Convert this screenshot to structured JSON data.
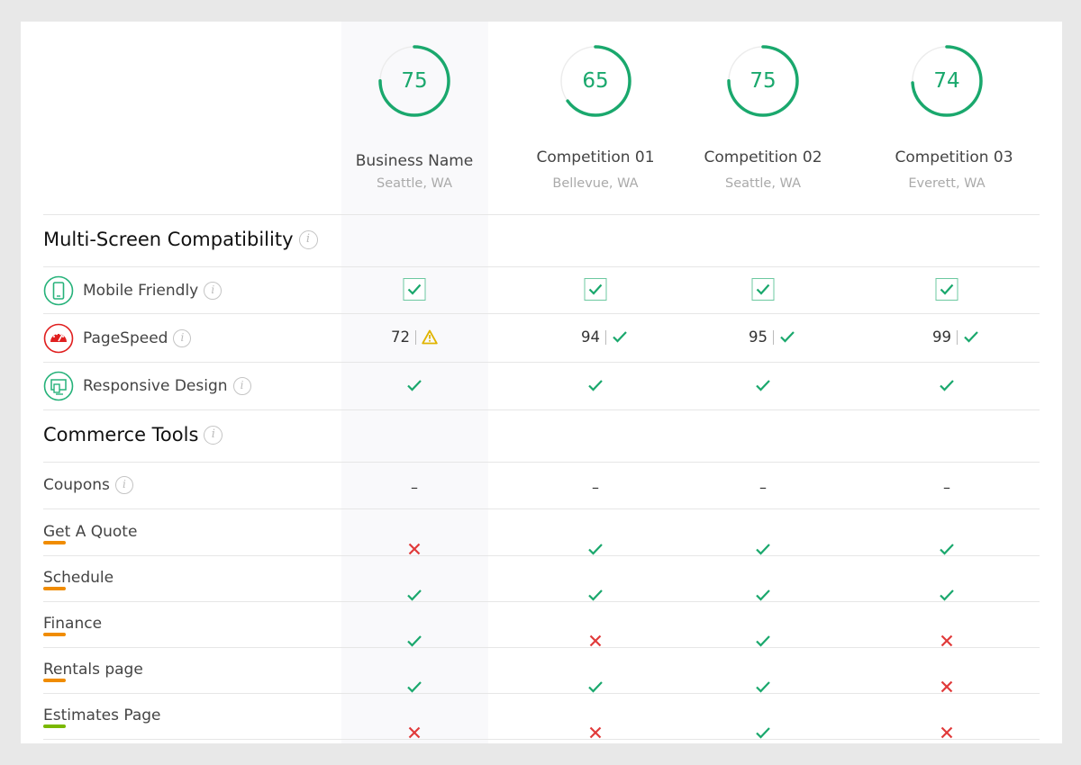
{
  "competitors": [
    {
      "score": 75,
      "name": "Business Name",
      "location": "Seattle, WA"
    },
    {
      "score": 65,
      "name": "Competition 01",
      "location": "Bellevue, WA"
    },
    {
      "score": 75,
      "name": "Competition 02",
      "location": "Seattle, WA"
    },
    {
      "score": 74,
      "name": "Competition 03",
      "location": "Everett, WA"
    }
  ],
  "sections": {
    "multi_screen": "Multi-Screen Compatibility",
    "commerce": "Commerce Tools"
  },
  "rows": {
    "mobile_friendly": {
      "label": "Mobile Friendly",
      "values": [
        "checkbox",
        "checkbox",
        "checkbox",
        "checkbox"
      ]
    },
    "pagespeed": {
      "label": "PageSpeed",
      "scores": [
        72,
        94,
        95,
        99
      ],
      "status": [
        "warning",
        "check",
        "check",
        "check"
      ]
    },
    "responsive_design": {
      "label": "Responsive Design",
      "values": [
        "check",
        "check",
        "check",
        "check"
      ]
    },
    "coupons": {
      "label": "Coupons",
      "values": [
        "–",
        "–",
        "–",
        "–"
      ]
    },
    "get_a_quote": {
      "label": "Get A Quote",
      "values": [
        "cross",
        "check",
        "check",
        "check"
      ]
    },
    "schedule": {
      "label": "Schedule",
      "values": [
        "check",
        "check",
        "check",
        "check"
      ]
    },
    "finance": {
      "label": "Finance",
      "values": [
        "check",
        "cross",
        "check",
        "cross"
      ]
    },
    "rentals_page": {
      "label": "Rentals page",
      "values": [
        "check",
        "check",
        "check",
        "cross"
      ]
    },
    "estimates_page": {
      "label": "Estimates Page",
      "values": [
        "cross",
        "cross",
        "check",
        "cross"
      ]
    }
  },
  "icons": {
    "info": "i",
    "mobile": "mobile-phone-icon",
    "speed": "speedometer-icon",
    "responsive": "responsive-devices-icon"
  },
  "colors": {
    "score_ring": "#1aa86d",
    "check": "#1aa86d",
    "cross": "#e03a3a",
    "warning": "#e0b400",
    "underline_orange": "#f08c00",
    "underline_green": "#7ab800",
    "pagespeed_icon": "#e02020"
  }
}
